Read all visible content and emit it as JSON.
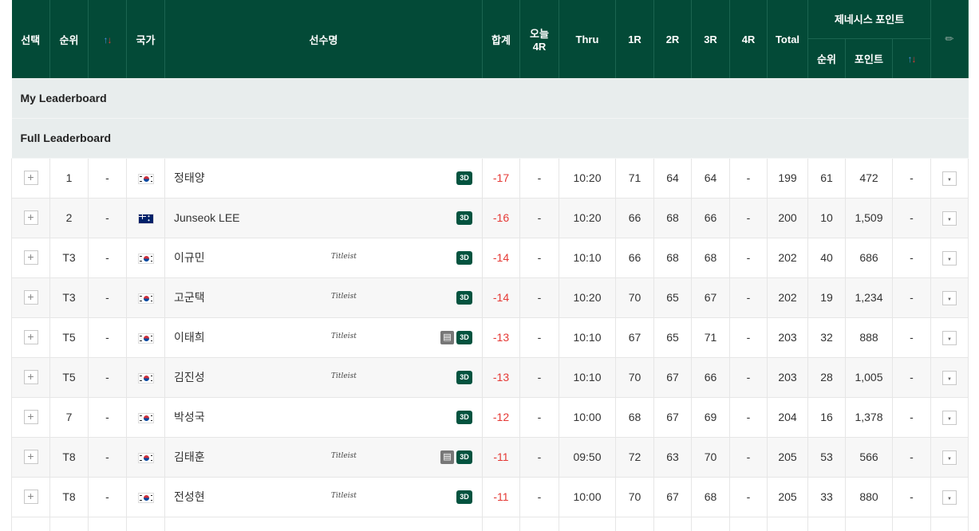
{
  "header": {
    "select": "선택",
    "rank": "순위",
    "sort_up": "↑",
    "sort_down": "↓",
    "country": "국가",
    "player": "선수명",
    "total_score": "합계",
    "today_line1": "오늘",
    "today_line2": "4R",
    "thru": "Thru",
    "r1": "1R",
    "r2": "2R",
    "r3": "3R",
    "r4": "4R",
    "total": "Total",
    "genesis": "제네시스 포인트",
    "genesis_rank": "순위",
    "genesis_points": "포인트",
    "pin_icon": "pin-icon"
  },
  "sections": {
    "my": "My Leaderboard",
    "full": "Full Leaderboard"
  },
  "rows": [
    {
      "rank": "1",
      "move": "-",
      "flag": "kr",
      "name": "정태양",
      "titleist": "",
      "doc": false,
      "score": "-17",
      "today": "-",
      "thru": "10:20",
      "r1": "71",
      "r2": "64",
      "r3": "64",
      "r4": "-",
      "total": "199",
      "gp_rank": "61",
      "gp_points": "472",
      "gp_move": "-"
    },
    {
      "rank": "2",
      "move": "-",
      "flag": "au",
      "name": "Junseok LEE",
      "titleist": "",
      "doc": false,
      "score": "-16",
      "today": "-",
      "thru": "10:20",
      "r1": "66",
      "r2": "68",
      "r3": "66",
      "r4": "-",
      "total": "200",
      "gp_rank": "10",
      "gp_points": "1,509",
      "gp_move": "-"
    },
    {
      "rank": "T3",
      "move": "-",
      "flag": "kr",
      "name": "이규민",
      "titleist": "Titleist",
      "doc": false,
      "score": "-14",
      "today": "-",
      "thru": "10:10",
      "r1": "66",
      "r2": "68",
      "r3": "68",
      "r4": "-",
      "total": "202",
      "gp_rank": "40",
      "gp_points": "686",
      "gp_move": "-"
    },
    {
      "rank": "T3",
      "move": "-",
      "flag": "kr",
      "name": "고군택",
      "titleist": "Titleist",
      "doc": false,
      "score": "-14",
      "today": "-",
      "thru": "10:20",
      "r1": "70",
      "r2": "65",
      "r3": "67",
      "r4": "-",
      "total": "202",
      "gp_rank": "19",
      "gp_points": "1,234",
      "gp_move": "-"
    },
    {
      "rank": "T5",
      "move": "-",
      "flag": "kr",
      "name": "이태희",
      "titleist": "Titleist",
      "doc": true,
      "score": "-13",
      "today": "-",
      "thru": "10:10",
      "r1": "67",
      "r2": "65",
      "r3": "71",
      "r4": "-",
      "total": "203",
      "gp_rank": "32",
      "gp_points": "888",
      "gp_move": "-"
    },
    {
      "rank": "T5",
      "move": "-",
      "flag": "kr",
      "name": "김진성",
      "titleist": "Titleist",
      "doc": false,
      "score": "-13",
      "today": "-",
      "thru": "10:10",
      "r1": "70",
      "r2": "67",
      "r3": "66",
      "r4": "-",
      "total": "203",
      "gp_rank": "28",
      "gp_points": "1,005",
      "gp_move": "-"
    },
    {
      "rank": "7",
      "move": "-",
      "flag": "kr",
      "name": "박성국",
      "titleist": "",
      "doc": false,
      "score": "-12",
      "today": "-",
      "thru": "10:00",
      "r1": "68",
      "r2": "67",
      "r3": "69",
      "r4": "-",
      "total": "204",
      "gp_rank": "16",
      "gp_points": "1,378",
      "gp_move": "-"
    },
    {
      "rank": "T8",
      "move": "-",
      "flag": "kr",
      "name": "김태훈",
      "titleist": "Titleist",
      "doc": true,
      "score": "-11",
      "today": "-",
      "thru": "09:50",
      "r1": "72",
      "r2": "63",
      "r3": "70",
      "r4": "-",
      "total": "205",
      "gp_rank": "53",
      "gp_points": "566",
      "gp_move": "-"
    },
    {
      "rank": "T8",
      "move": "-",
      "flag": "kr",
      "name": "전성현",
      "titleist": "Titleist",
      "doc": false,
      "score": "-11",
      "today": "-",
      "thru": "10:00",
      "r1": "70",
      "r2": "67",
      "r3": "68",
      "r4": "-",
      "total": "205",
      "gp_rank": "33",
      "gp_points": "880",
      "gp_move": "-"
    }
  ],
  "icons": {
    "expand": "+",
    "badge_3d": "3D",
    "doc": "▤",
    "dropdown": "▼"
  },
  "colors": {
    "header_bg": "#034a37",
    "section_bg": "#e8eded",
    "score_red": "#e53935",
    "badge_green": "#03533f"
  }
}
